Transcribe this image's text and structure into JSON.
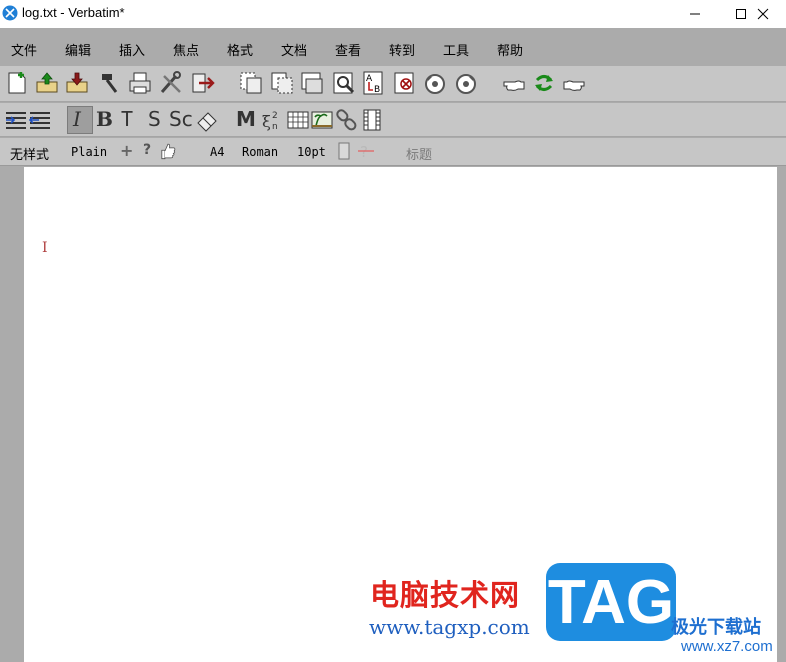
{
  "window": {
    "title": "log.txt - Verbatim*",
    "controls": [
      "minimize-icon",
      "maximize-icon",
      "close-icon"
    ]
  },
  "menu": {
    "items": [
      "文件",
      "编辑",
      "插入",
      "焦点",
      "格式",
      "文档",
      "查看",
      "转到",
      "工具",
      "帮助"
    ]
  },
  "toolbar1": {
    "icons": [
      "new-document-icon",
      "open-icon",
      "save-icon",
      "hammer-icon",
      "print-icon",
      "tools-icon",
      "exit-icon",
      "copy-frame-icon",
      "cut-frame-icon",
      "paste-frame-icon",
      "zoom-icon",
      "spell-check-icon",
      "delete-icon",
      "undo-icon",
      "redo-icon",
      "hand-back-icon",
      "refresh-icon",
      "hand-forward-icon"
    ]
  },
  "toolbar2": {
    "glyphs": {
      "italic": "I",
      "bold": "B",
      "typewriter": "T",
      "sans": "S",
      "smallcaps": "Sc",
      "math": "M"
    },
    "icons": [
      "indent-icon",
      "outdent-icon",
      "eraser-icon",
      "math-icon",
      "formula-icon",
      "table-icon",
      "image-icon",
      "link-icon",
      "film-icon"
    ]
  },
  "statusbar": {
    "style": "无样式",
    "font_style": "Plain",
    "plus": "+",
    "question": "?",
    "paper": "A4",
    "font": "Roman",
    "size": "10pt",
    "heading": "标题"
  },
  "document": {
    "cursor": "I"
  },
  "watermark": {
    "cn_text": "电脑技术网",
    "url": "www.tagxp.com",
    "tag": "TAG",
    "site_cn": "极光下载站",
    "site_url": "www.xz7.com"
  },
  "colors": {
    "chrome": "#ababab",
    "toolbar": "#c6c6c6",
    "page": "#ffffff",
    "watermark_red": "#e0251e",
    "watermark_blue": "#1e8de0"
  }
}
